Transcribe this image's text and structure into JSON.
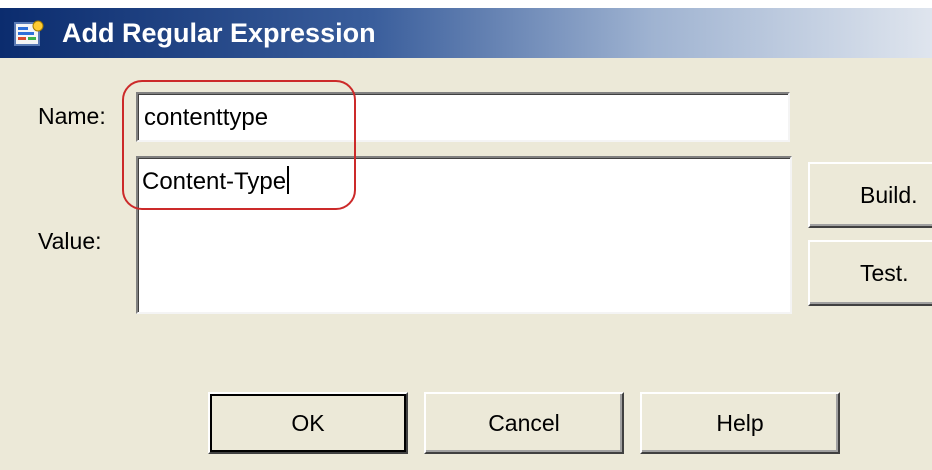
{
  "dialog": {
    "title": "Add Regular Expression",
    "icon": "regex-dialog-icon"
  },
  "form": {
    "name_label": "Name:",
    "name_value": "contenttype",
    "value_label": "Value:",
    "value_value": "Content-Type"
  },
  "side_buttons": {
    "build_label": "Build.",
    "test_label": "Test."
  },
  "footer_buttons": {
    "ok_label": "OK",
    "cancel_label": "Cancel",
    "help_label": "Help"
  },
  "colors": {
    "titlebar_start": "#0b2c6e",
    "titlebar_end": "#dfe5ee",
    "highlight": "#cc2a2a",
    "dialog_bg": "#ece9d8"
  }
}
